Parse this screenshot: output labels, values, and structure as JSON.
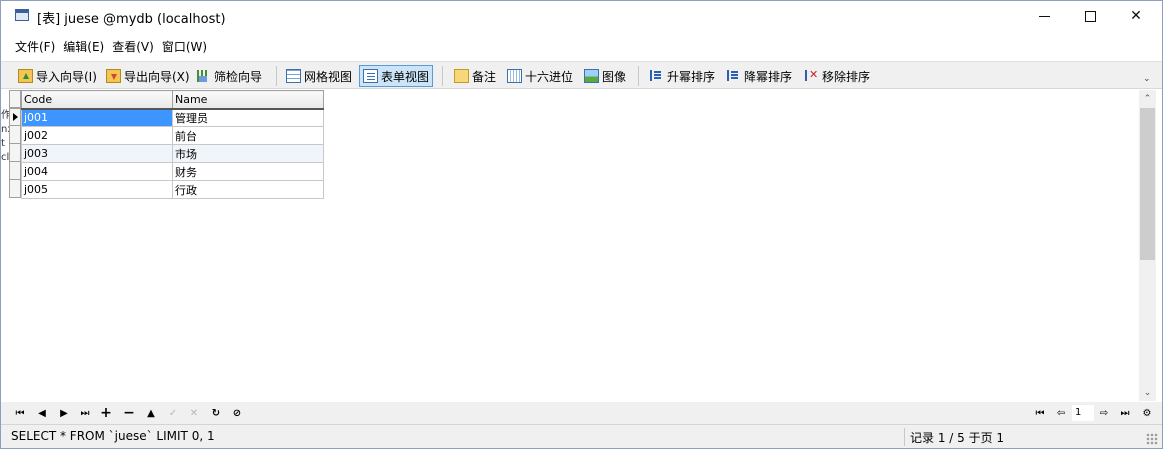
{
  "window": {
    "title": "[表] juese @mydb (localhost)",
    "controls": {
      "minimize": "",
      "maximize": "",
      "close": "✕"
    }
  },
  "menu": [
    "文件(F)",
    "编辑(E)",
    "查看(V)",
    "窗口(W)"
  ],
  "toolbar": {
    "import_wizard": "导入向导(I)",
    "export_wizard": "导出向导(X)",
    "filter_wizard": "筛检向导",
    "grid_view": "网格视图",
    "form_view": "表单视图",
    "memo": "备注",
    "hex": "十六进位",
    "image": "图像",
    "sort_asc": "升幂排序",
    "sort_desc": "降幂排序",
    "remove_sort": "移除排序",
    "active_view": "form_view"
  },
  "grid": {
    "columns": [
      "Code",
      "Name"
    ],
    "rows": [
      {
        "code": "j001",
        "name": "管理员"
      },
      {
        "code": "j002",
        "name": "前台"
      },
      {
        "code": "j003",
        "name": "市场"
      },
      {
        "code": "j004",
        "name": "财务"
      },
      {
        "code": "j005",
        "name": "行政"
      }
    ],
    "selected_row": 0
  },
  "clipped_left_text": [
    "作",
    "nx",
    "t",
    "",
    "cl"
  ],
  "navigator": {
    "page": "1"
  },
  "status": {
    "sql": "SELECT * FROM `juese` LIMIT 0, 1",
    "record": "记录 1 / 5 于页 1"
  },
  "colors": {
    "selection": "#3d95ff",
    "active_button_bg": "#cce4f7",
    "alt_row": "#f0f4fb"
  }
}
